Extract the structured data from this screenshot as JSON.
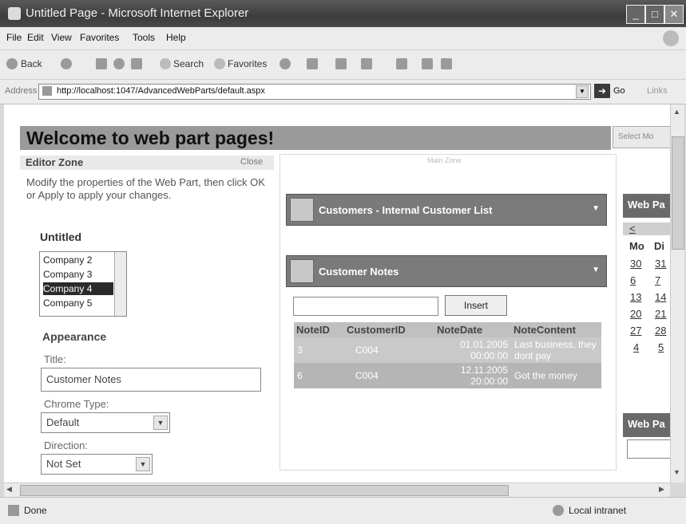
{
  "window": {
    "title": "Untitled Page - Microsoft Internet Explorer"
  },
  "menu": [
    "File",
    "Edit",
    "View",
    "Favorites",
    "Tools",
    "Help"
  ],
  "toolbar": {
    "back": "Back",
    "search": "Search",
    "favorites": "Favorites"
  },
  "address": {
    "label": "Address",
    "url": "http://localhost:1047/AdvancedWebParts/default.aspx",
    "go": "Go",
    "links": "Links"
  },
  "page": {
    "welcome": "Welcome to web part pages!",
    "select_mode": "Select Mo",
    "main_zone_title": "Main Zone"
  },
  "editor": {
    "title": "Editor Zone",
    "close": "Close",
    "description": "Modify the properties of the Web Part, then click OK or Apply to apply your changes.",
    "part_title": "Untitled",
    "list_items": [
      "Company 2",
      "Company 3",
      "Company 4",
      "Company 5"
    ],
    "selected_index": 2,
    "appearance": "Appearance",
    "title_label": "Title:",
    "title_value": "Customer Notes",
    "chrome_type_label": "Chrome Type:",
    "chrome_type_value": "Default",
    "direction_label": "Direction:",
    "direction_value": "Not Set"
  },
  "customers_part": {
    "title": "Customers - Internal Customer List"
  },
  "notes_part": {
    "title": "Customer Notes",
    "insert_label": "Insert",
    "columns": [
      "NoteID",
      "CustomerID",
      "NoteDate",
      "NoteContent"
    ],
    "rows": [
      [
        "3",
        "C004",
        "01.01.2005 00:00:00",
        "Last business, they dont pay"
      ],
      [
        "6",
        "C004",
        "12.11.2005 20:00:00",
        "Got the money"
      ]
    ]
  },
  "calendar_part": {
    "title": "Web Pa",
    "prev": "<",
    "days": [
      "Mo",
      "Di"
    ],
    "weeks": [
      [
        "30",
        "31"
      ],
      [
        "6",
        "7"
      ],
      [
        "13",
        "14"
      ],
      [
        "20",
        "21"
      ],
      [
        "27",
        "28"
      ],
      [
        "4",
        "5"
      ]
    ]
  },
  "second_part": {
    "title": "Web Pa"
  },
  "status": {
    "text": "Done",
    "zone": "Local intranet"
  }
}
